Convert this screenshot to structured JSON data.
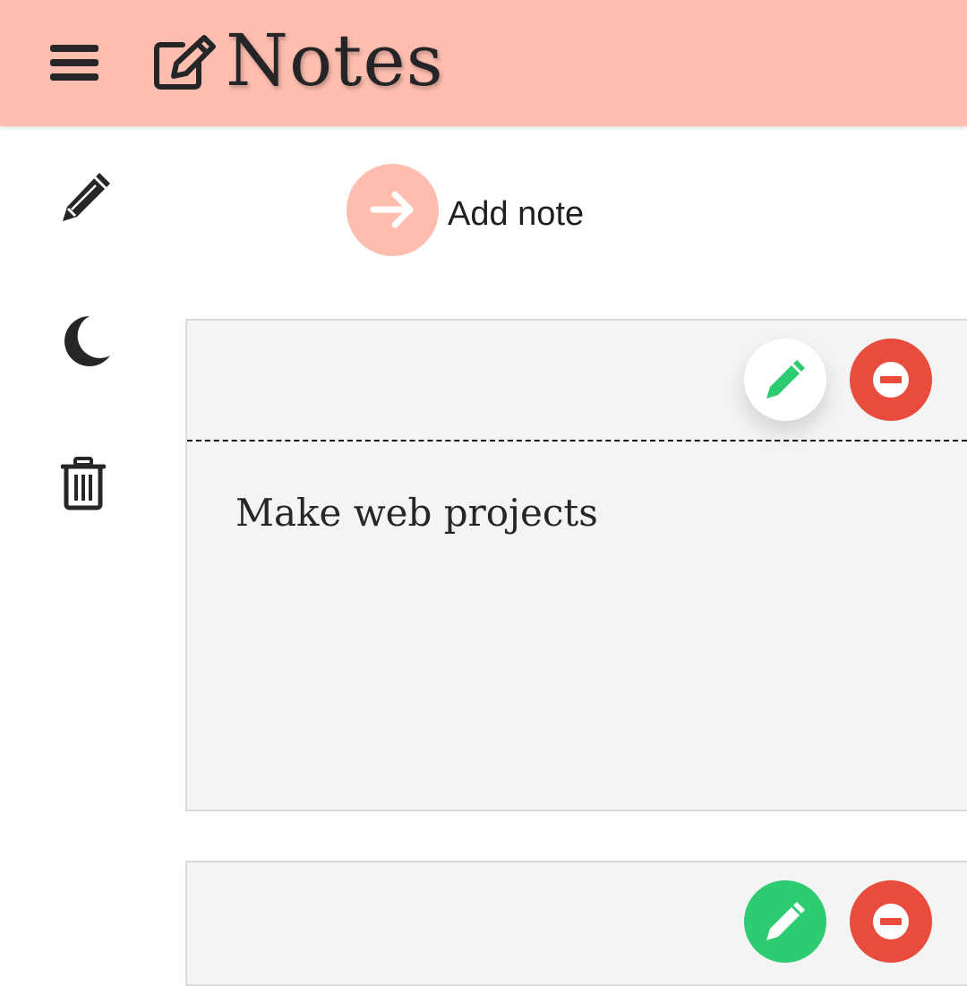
{
  "header": {
    "title": "Notes",
    "menu_icon": "hamburger-menu-icon",
    "brand_icon": "edit-note-icon",
    "background": "#fdbdaf"
  },
  "sidebar": {
    "items": [
      {
        "icon": "pencil-icon"
      },
      {
        "icon": "moon-icon"
      },
      {
        "icon": "trash-icon"
      }
    ]
  },
  "add_note": {
    "label": "Add note",
    "icon": "arrow-right-icon",
    "color": "#fdbdaf"
  },
  "notes": [
    {
      "text": "Make web projects",
      "edit_icon": "pencil-icon",
      "delete_icon": "minus-circle-icon",
      "edit_state": "active"
    },
    {
      "text": "",
      "edit_icon": "pencil-icon",
      "delete_icon": "minus-circle-icon",
      "edit_state": "default"
    }
  ],
  "colors": {
    "accent": "#fdbdaf",
    "edit": "#2ecc71",
    "delete": "#e74c3c",
    "note_background": "#f4f4f4"
  }
}
